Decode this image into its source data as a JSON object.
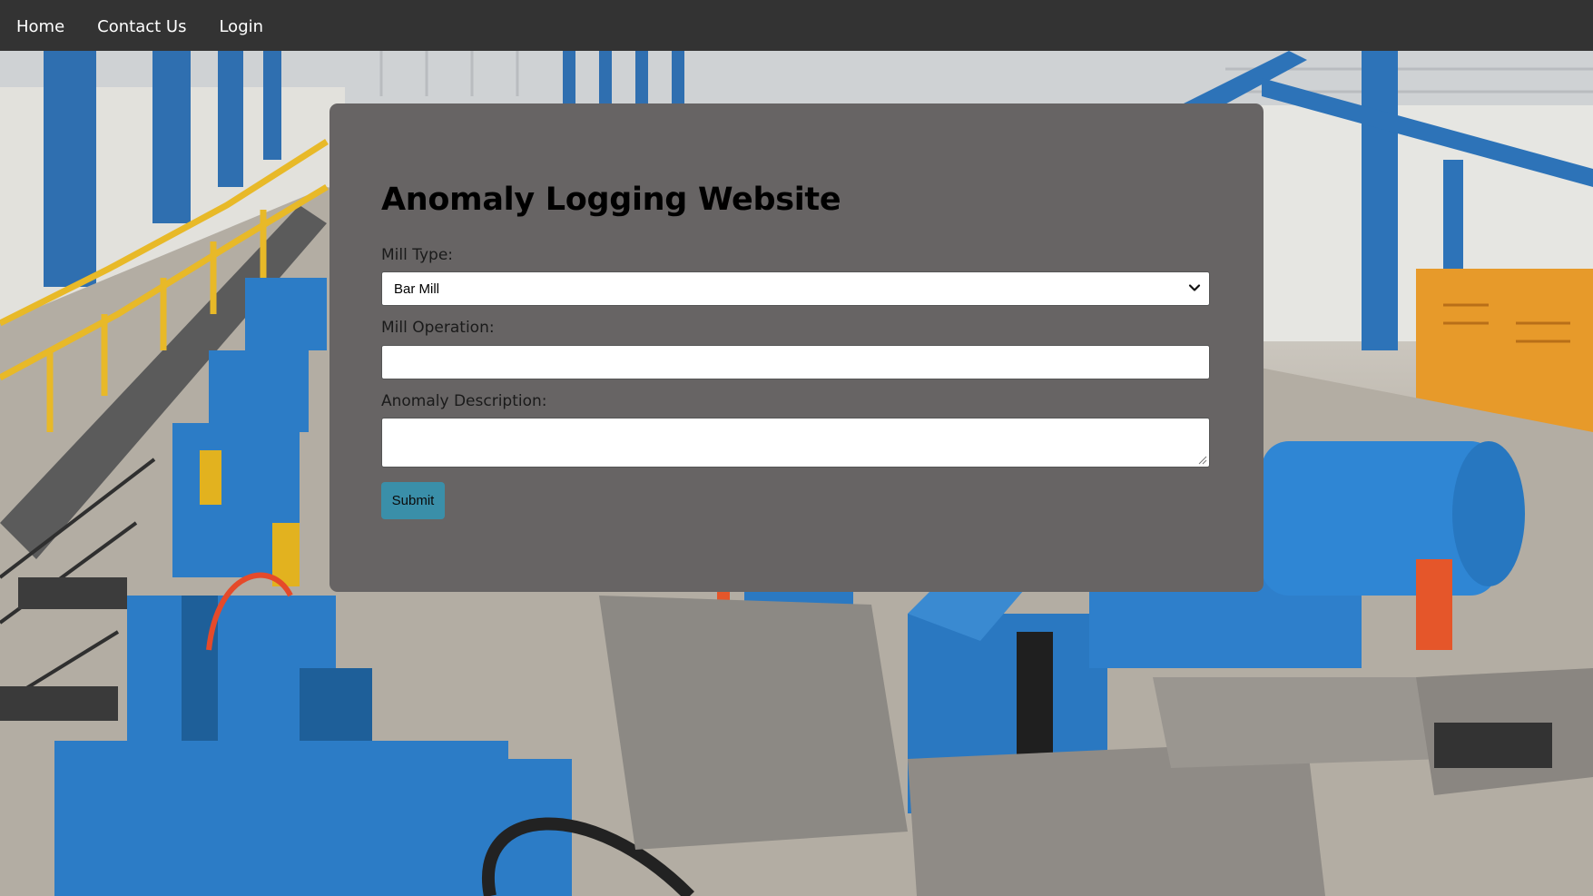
{
  "nav": {
    "items": [
      {
        "label": "Home"
      },
      {
        "label": "Contact Us"
      },
      {
        "label": "Login"
      }
    ]
  },
  "form": {
    "title": "Anomaly Logging Website",
    "mill_type": {
      "label": "Mill Type:",
      "selected": "Bar Mill"
    },
    "mill_operation": {
      "label": "Mill Operation:",
      "value": ""
    },
    "anomaly_description": {
      "label": "Anomaly Description:",
      "value": ""
    },
    "submit_label": "Submit"
  },
  "colors": {
    "navbar": "#333333",
    "panel": "#676464",
    "submit_button": "#3a8fa9",
    "machinery_blue": "#2b7fc4",
    "railing_yellow": "#e8b928"
  },
  "icons": {
    "select_chevron": "chevron-down-icon",
    "textarea_resize": "resize-grip-icon"
  }
}
